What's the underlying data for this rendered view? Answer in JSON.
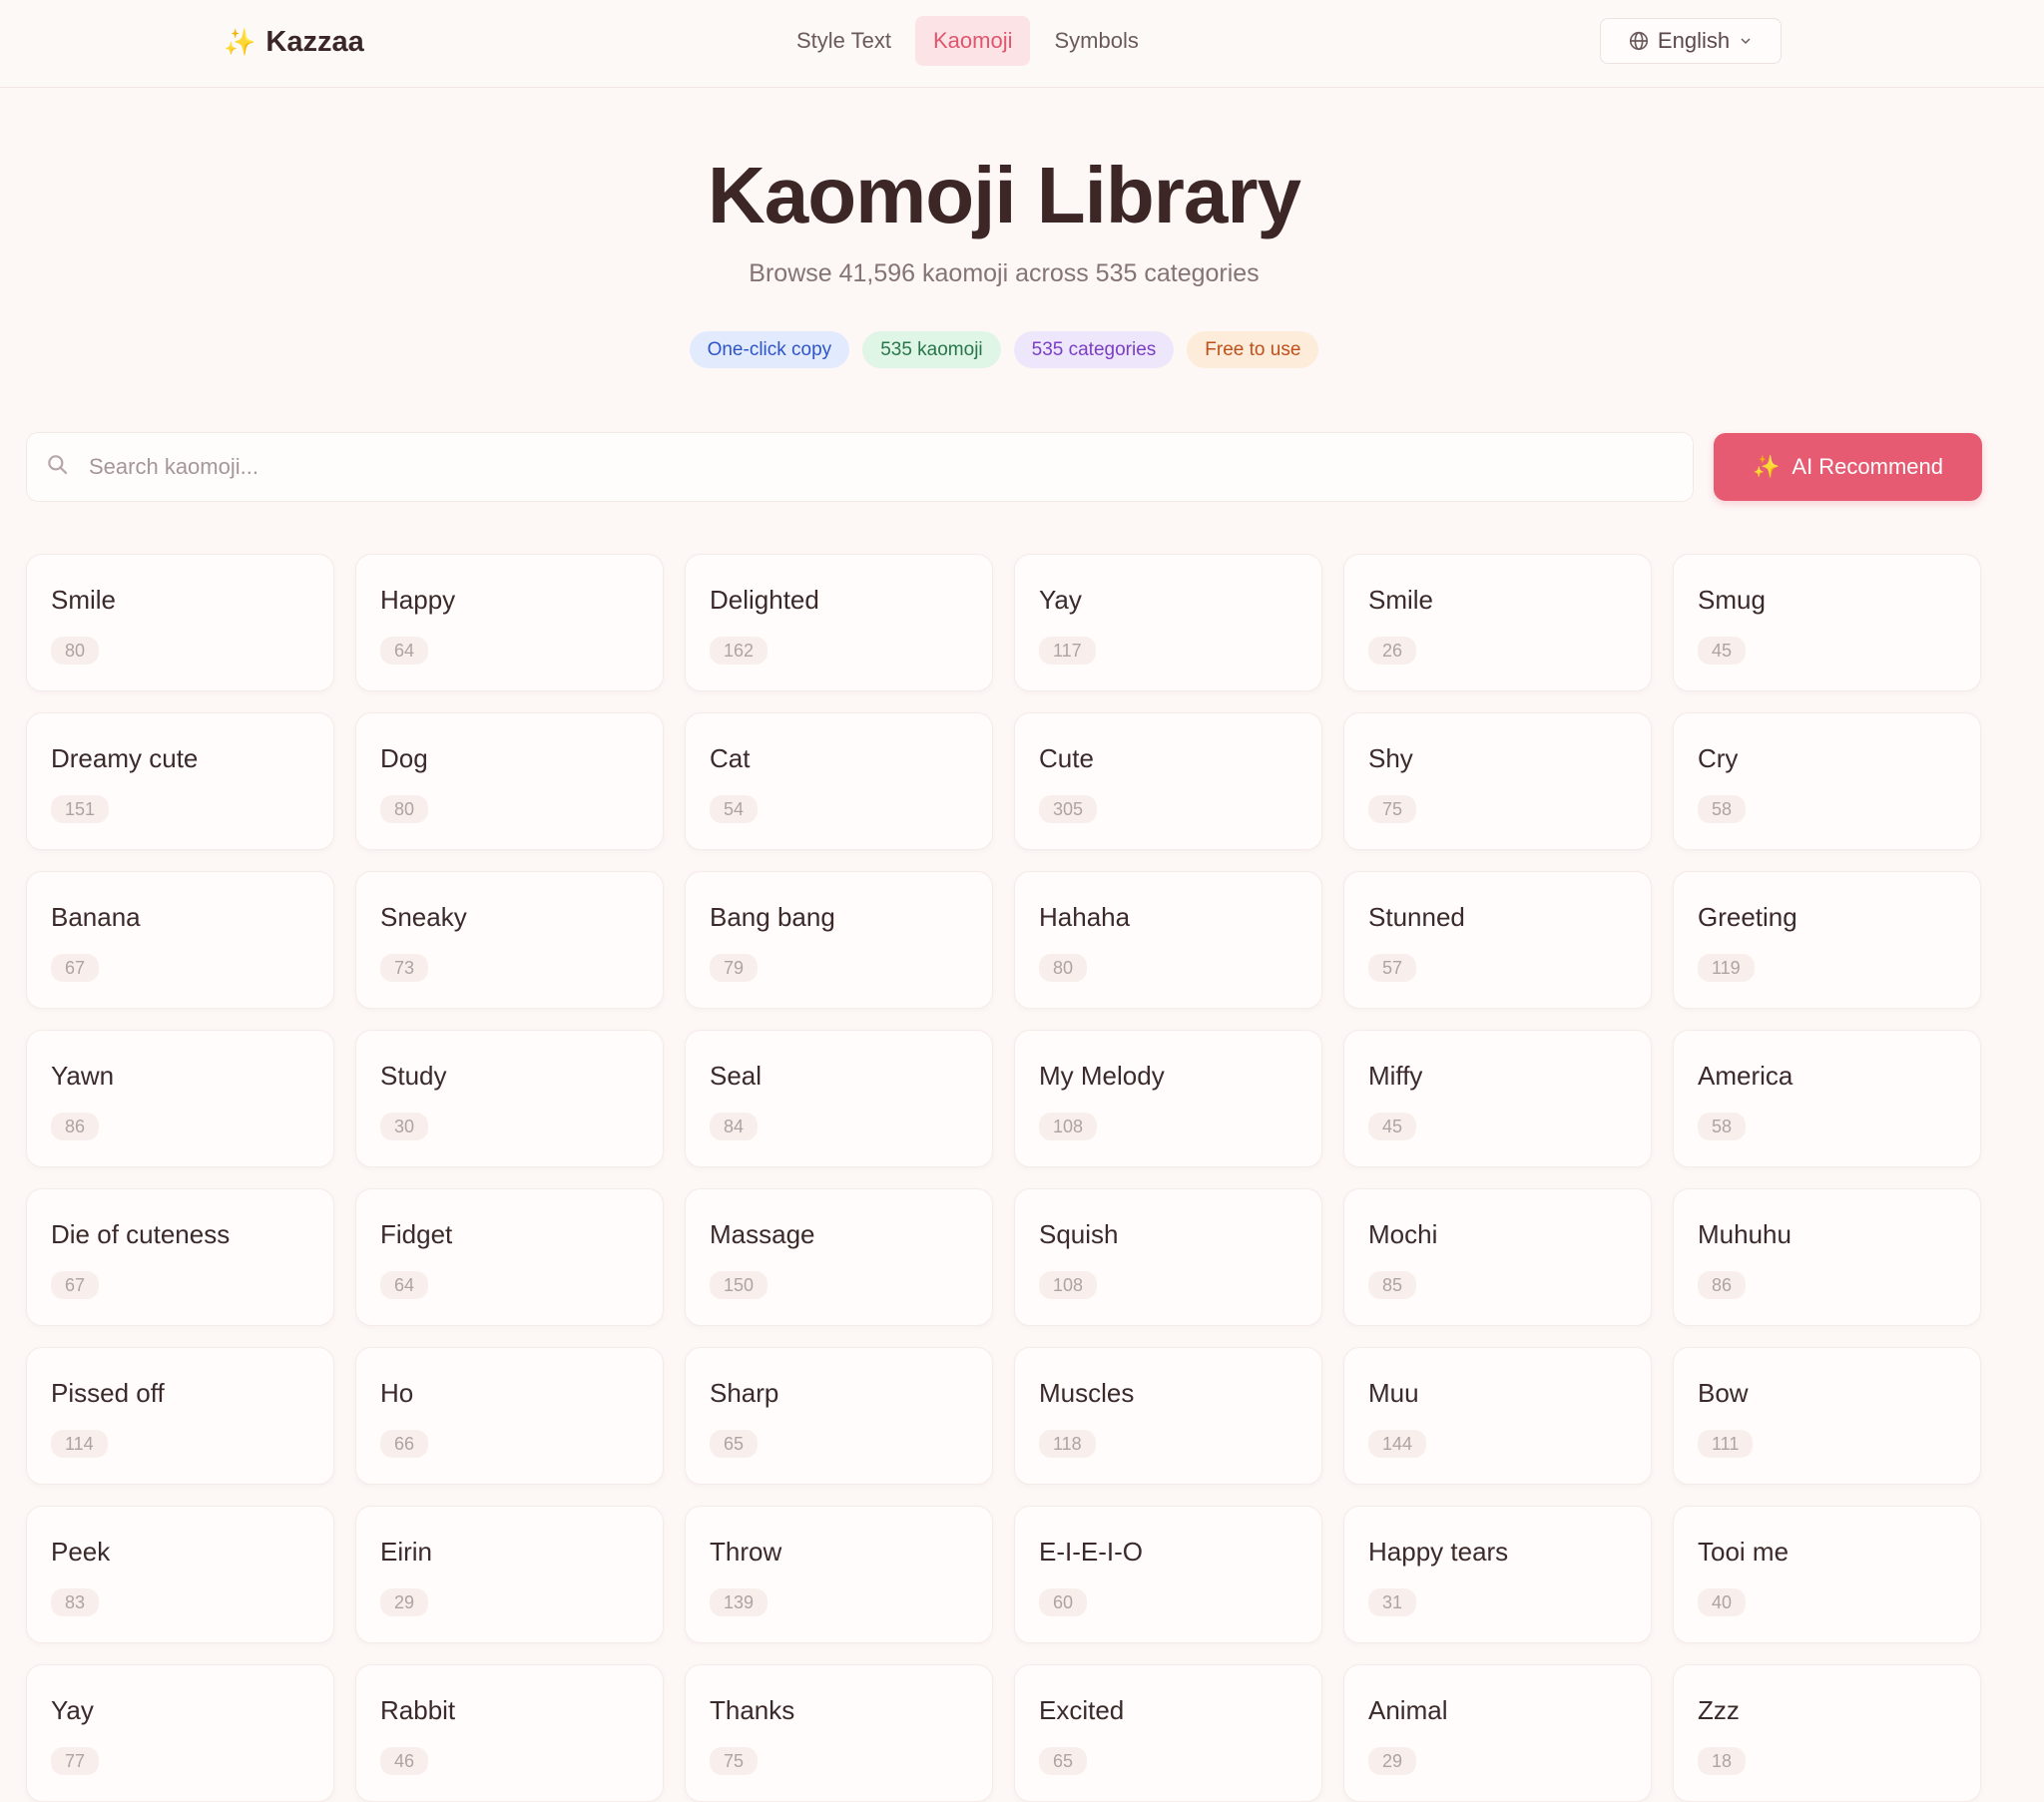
{
  "brand": {
    "icon": "sparkles-icon",
    "name": "Kazzaa"
  },
  "nav": [
    {
      "label": "Style Text",
      "active": false
    },
    {
      "label": "Kaomoji",
      "active": true
    },
    {
      "label": "Symbols",
      "active": false
    }
  ],
  "language": {
    "icon": "globe-icon",
    "label": "English"
  },
  "hero": {
    "title": "Kaomoji Library",
    "subtitle": "Browse 41,596 kaomoji across 535 categories",
    "badges": [
      {
        "label": "One-click copy",
        "color": "#e2ebfd"
      },
      {
        "label": "535 kaomoji",
        "color": "#dff5e6"
      },
      {
        "label": "535 categories",
        "color": "#eee6fb"
      },
      {
        "label": "Free to use",
        "color": "#fdecda"
      }
    ]
  },
  "search": {
    "placeholder": "Search kaomoji...",
    "value": ""
  },
  "ai_button": {
    "label": "AI Recommend",
    "color": "#e65b72"
  },
  "categories": [
    {
      "name": "Smile",
      "count": "80"
    },
    {
      "name": "Happy",
      "count": "64"
    },
    {
      "name": "Delighted",
      "count": "162"
    },
    {
      "name": "Yay",
      "count": "117"
    },
    {
      "name": "Smile",
      "count": "26"
    },
    {
      "name": "Smug",
      "count": "45"
    },
    {
      "name": "Dreamy cute",
      "count": "151"
    },
    {
      "name": "Dog",
      "count": "80"
    },
    {
      "name": "Cat",
      "count": "54"
    },
    {
      "name": "Cute",
      "count": "305"
    },
    {
      "name": "Shy",
      "count": "75"
    },
    {
      "name": "Cry",
      "count": "58"
    },
    {
      "name": "Banana",
      "count": "67"
    },
    {
      "name": "Sneaky",
      "count": "73"
    },
    {
      "name": "Bang bang",
      "count": "79"
    },
    {
      "name": "Hahaha",
      "count": "80"
    },
    {
      "name": "Stunned",
      "count": "57"
    },
    {
      "name": "Greeting",
      "count": "119"
    },
    {
      "name": "Yawn",
      "count": "86"
    },
    {
      "name": "Study",
      "count": "30"
    },
    {
      "name": "Seal",
      "count": "84"
    },
    {
      "name": "My Melody",
      "count": "108"
    },
    {
      "name": "Miffy",
      "count": "45"
    },
    {
      "name": "America",
      "count": "58"
    },
    {
      "name": "Die of cuteness",
      "count": "67"
    },
    {
      "name": "Fidget",
      "count": "64"
    },
    {
      "name": "Massage",
      "count": "150"
    },
    {
      "name": "Squish",
      "count": "108"
    },
    {
      "name": "Mochi",
      "count": "85"
    },
    {
      "name": "Muhuhu",
      "count": "86"
    },
    {
      "name": "Pissed off",
      "count": "114"
    },
    {
      "name": "Ho",
      "count": "66"
    },
    {
      "name": "Sharp",
      "count": "65"
    },
    {
      "name": "Muscles",
      "count": "118"
    },
    {
      "name": "Muu",
      "count": "144"
    },
    {
      "name": "Bow",
      "count": "111"
    },
    {
      "name": "Peek",
      "count": "83"
    },
    {
      "name": "Eirin",
      "count": "29"
    },
    {
      "name": "Throw",
      "count": "139"
    },
    {
      "name": "E-I-E-I-O",
      "count": "60"
    },
    {
      "name": "Happy tears",
      "count": "31"
    },
    {
      "name": "Tooi me",
      "count": "40"
    },
    {
      "name": "Yay",
      "count": "77"
    },
    {
      "name": "Rabbit",
      "count": "46"
    },
    {
      "name": "Thanks",
      "count": "75"
    },
    {
      "name": "Excited",
      "count": "65"
    },
    {
      "name": "Animal",
      "count": "29"
    },
    {
      "name": "Zzz",
      "count": "18"
    }
  ]
}
